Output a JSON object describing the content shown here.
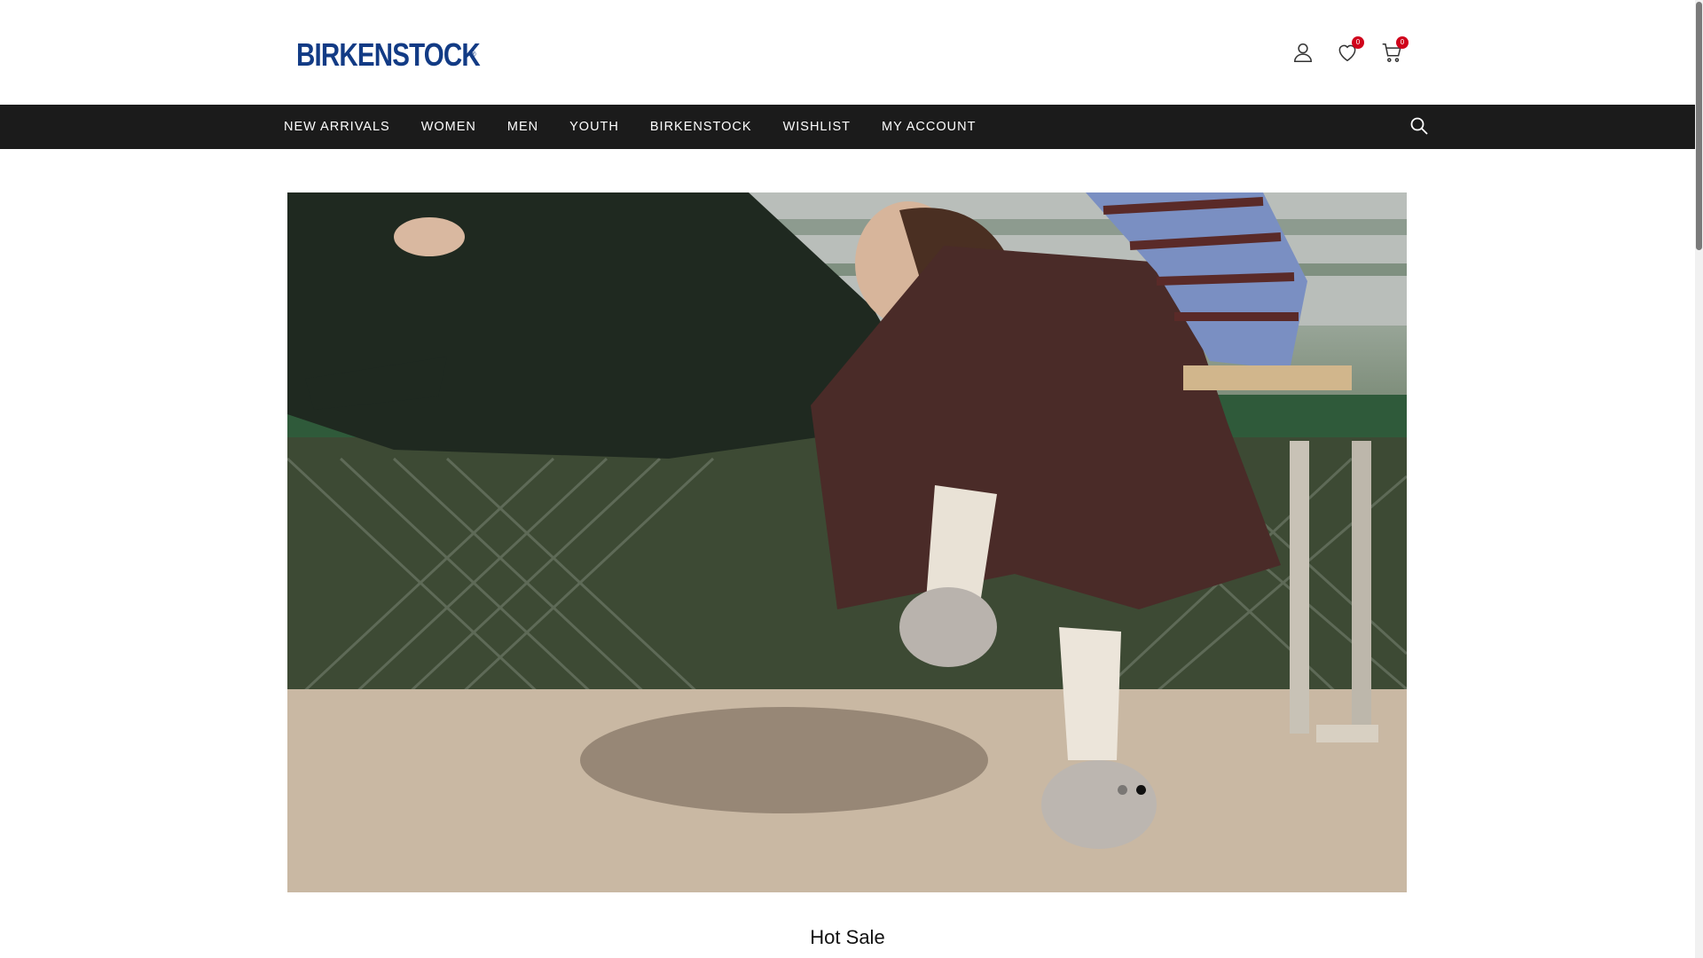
{
  "brand": {
    "logo_text": "BIRKENSTOCK",
    "logo_mark": "®",
    "color": "#123b85"
  },
  "header": {
    "account_icon": "user-icon",
    "wishlist": {
      "icon": "heart-icon",
      "count": "0"
    },
    "cart": {
      "icon": "cart-icon",
      "count": "0"
    },
    "badge_color": "#d0021b"
  },
  "nav": {
    "items": [
      {
        "label": "NEW ARRIVALS"
      },
      {
        "label": "WOMEN"
      },
      {
        "label": "MEN"
      },
      {
        "label": "YOUTH"
      },
      {
        "label": "BIRKENSTOCK"
      },
      {
        "label": "WISHLIST"
      },
      {
        "label": "MY ACCOUNT"
      }
    ],
    "search_icon": "search-icon",
    "background": "#1b1b1b"
  },
  "hero": {
    "slide_count": 2,
    "active_slide": 2
  },
  "section": {
    "title": "Hot Sale"
  }
}
